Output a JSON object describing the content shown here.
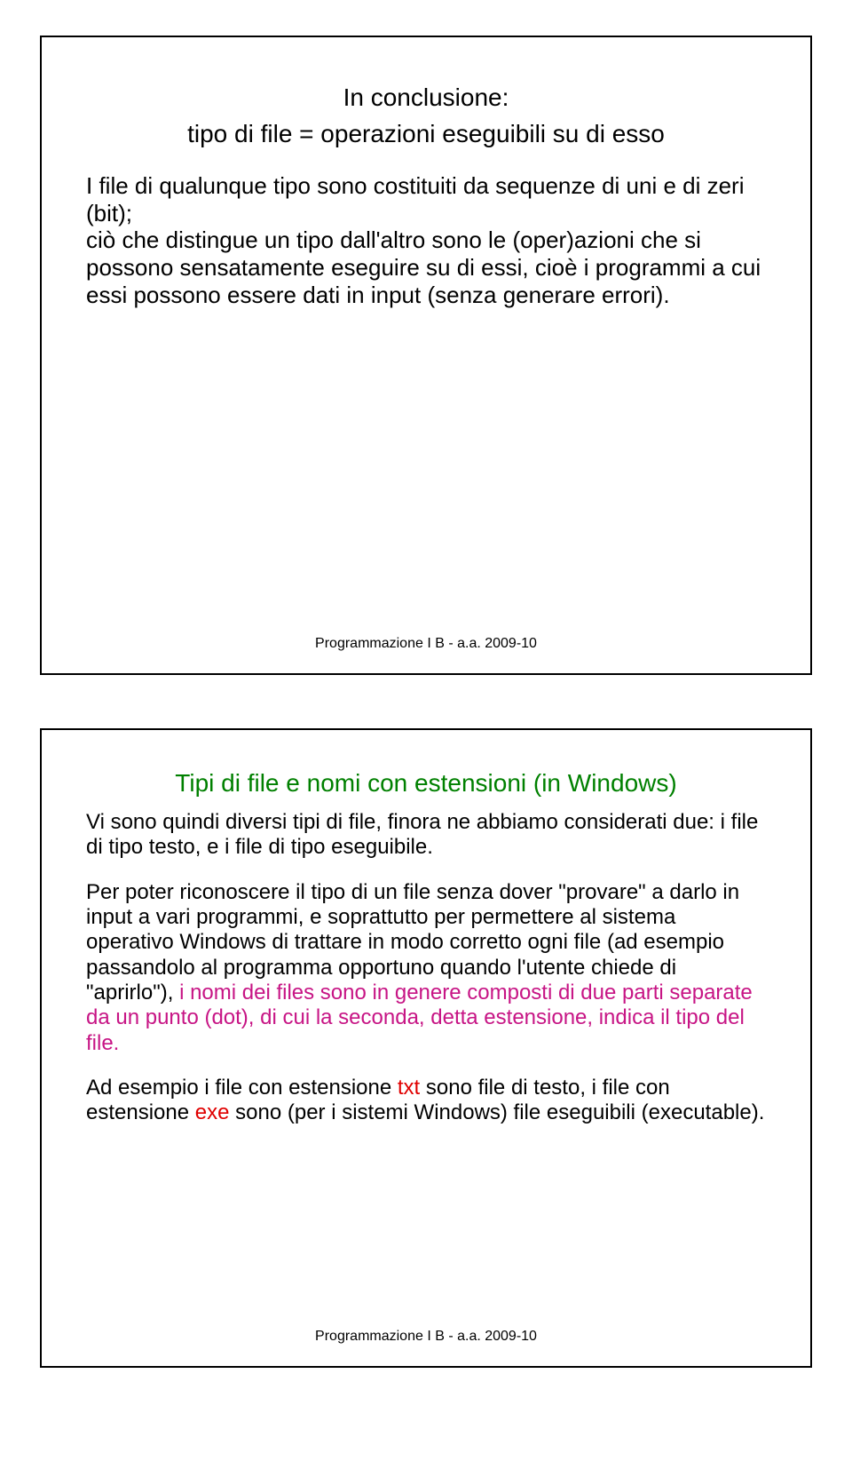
{
  "slide1": {
    "title_line1": "In conclusione:",
    "title_line2": "tipo di file = operazioni eseguibili su di esso",
    "body": "I file di qualunque tipo sono costituiti da sequenze di uni e di zeri (bit);\nciò che distingue un tipo dall'altro sono le (oper)azioni che si possono sensatamente eseguire su di essi, cioè i programmi a cui essi possono essere dati in input (senza generare errori).",
    "footer": "Programmazione I B - a.a. 2009-10"
  },
  "slide2": {
    "title": "Tipi di file e nomi con estensioni (in Windows)",
    "para1": "Vi sono quindi diversi tipi di file, finora ne abbiamo considerati due: i file di tipo testo, e i file di tipo eseguibile.",
    "para2_black_a": "Per poter riconoscere il tipo di un file senza dover \"provare\" a darlo in input a vari programmi, e soprattutto per permettere al sistema operativo Windows di trattare in modo corretto ogni file (ad esempio passandolo al programma opportuno quando l'utente chiede di  \"aprirlo\"), ",
    "para2_magenta": "i nomi dei files sono in genere composti di due parti separate da un punto (dot), di cui la seconda, detta estensione, indica il tipo del file.",
    "para3_prefix": "Ad esempio i file con estensione ",
    "para3_txt": "txt",
    "para3_mid1": " sono file di testo, i file con estensione ",
    "para3_exe": "exe",
    "para3_suffix": " sono (per i sistemi Windows) file eseguibili (executable).",
    "footer": "Programmazione I B - a.a. 2009-10"
  }
}
